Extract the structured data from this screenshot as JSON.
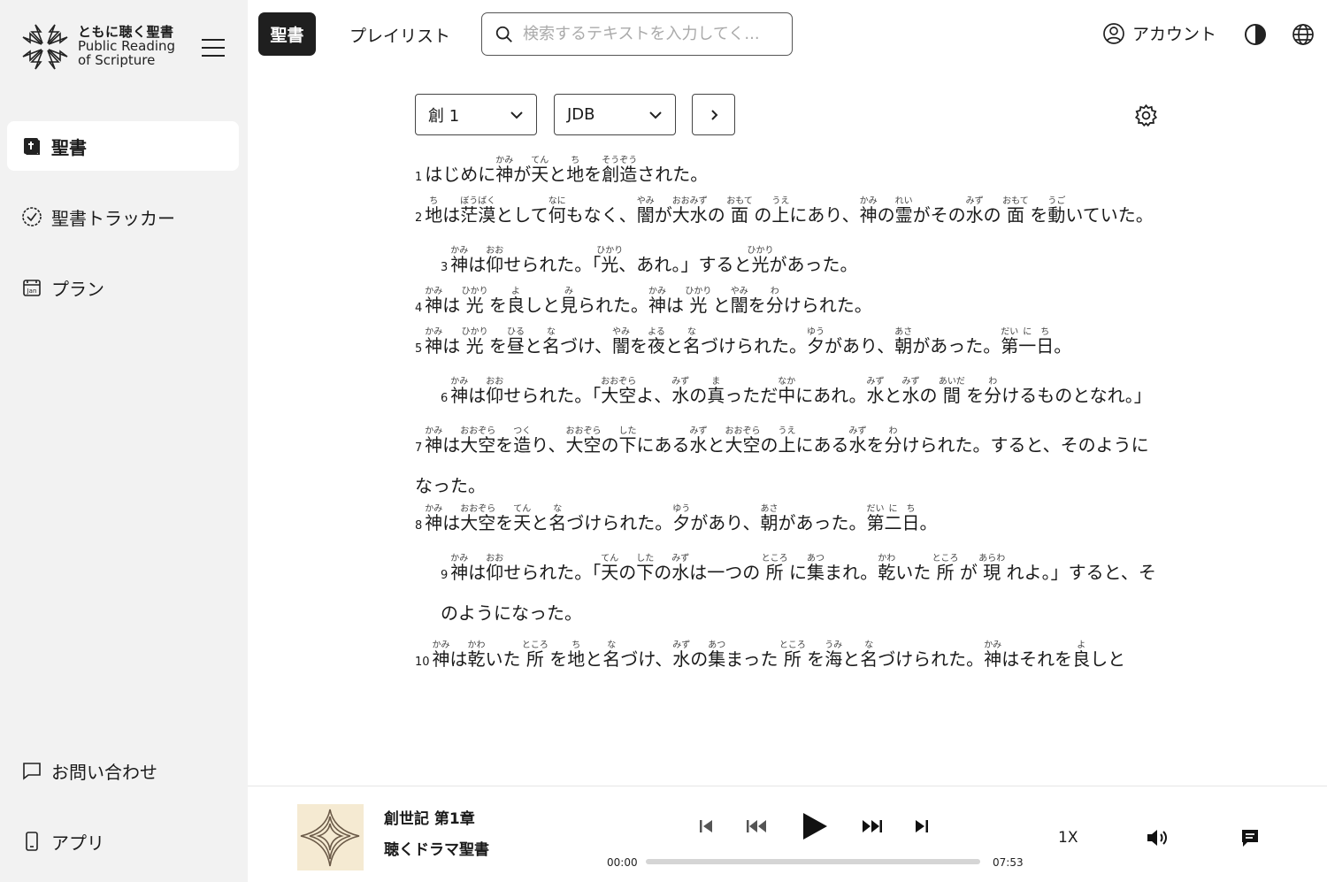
{
  "logo": {
    "title_jp": "ともに聴く聖書",
    "title_en_1": "Public Reading",
    "title_en_2": "of Scripture"
  },
  "sidebar": {
    "items": [
      {
        "label": "聖書",
        "icon": "bible-icon",
        "active": true
      },
      {
        "label": "聖書トラッカー",
        "icon": "check-circle-icon"
      },
      {
        "label": "プラン",
        "icon": "calendar-icon"
      }
    ],
    "bottom_items": [
      {
        "label": "お問い合わせ",
        "icon": "chat-icon"
      },
      {
        "label": "アプリ",
        "icon": "phone-icon"
      }
    ]
  },
  "topbar": {
    "tab_bible": "聖書",
    "tab_playlist": "プレイリスト",
    "search_placeholder": "検索するテキストを入力してく...",
    "account_label": "アカウント"
  },
  "controls": {
    "chapter": "創 1",
    "version": "JDB"
  },
  "reading": {
    "verses": [
      {
        "n": "1",
        "indent": false,
        "parts": [
          "はじめに",
          {
            "b": "神",
            "r": "かみ"
          },
          "が",
          {
            "b": "天",
            "r": "てん"
          },
          "と",
          {
            "b": "地",
            "r": "ち"
          },
          "を",
          {
            "b": "創造",
            "r": "そうぞう"
          },
          "された。"
        ]
      },
      {
        "n": "2",
        "indent": false,
        "parts": [
          {
            "b": "地",
            "r": "ち"
          },
          "は",
          {
            "b": "茫漠",
            "r": "ぼうばく"
          },
          "として",
          {
            "b": "何",
            "r": "なに"
          },
          "もなく、",
          {
            "b": "闇",
            "r": "やみ"
          },
          "が",
          {
            "b": "大水",
            "r": "おおみず"
          },
          "の ",
          {
            "b": "面",
            "r": "おもて"
          },
          " の",
          {
            "b": "上",
            "r": "うえ"
          },
          "にあり、",
          {
            "b": "神",
            "r": "かみ"
          },
          "の",
          {
            "b": "霊",
            "r": "れい"
          },
          "がその",
          {
            "b": "水",
            "r": "みず"
          },
          "の ",
          {
            "b": "面",
            "r": "おもて"
          },
          " を",
          {
            "b": "動",
            "r": "うご"
          },
          "いていた。"
        ]
      },
      {
        "n": "3",
        "indent": true,
        "parts": [
          {
            "b": "神",
            "r": "かみ"
          },
          "は",
          {
            "b": "仰",
            "r": "おお"
          },
          "せられた。「",
          {
            "b": "光",
            "r": "ひかり"
          },
          "、あれ。」すると",
          {
            "b": "光",
            "r": "ひかり"
          },
          "があった。"
        ]
      },
      {
        "n": "4",
        "indent": false,
        "parts": [
          {
            "b": "神",
            "r": "かみ"
          },
          "は ",
          {
            "b": "光",
            "r": "ひかり"
          },
          " を",
          {
            "b": "良",
            "r": "よ"
          },
          "しと",
          {
            "b": "見",
            "r": "み"
          },
          "られた。",
          {
            "b": "神",
            "r": "かみ"
          },
          "は ",
          {
            "b": "光",
            "r": "ひかり"
          },
          " と",
          {
            "b": "闇",
            "r": "やみ"
          },
          "を",
          {
            "b": "分",
            "r": "わ"
          },
          "けられた。"
        ]
      },
      {
        "n": "5",
        "indent": false,
        "parts": [
          {
            "b": "神",
            "r": "かみ"
          },
          "は ",
          {
            "b": "光",
            "r": "ひかり"
          },
          " を",
          {
            "b": "昼",
            "r": "ひる"
          },
          "と",
          {
            "b": "名",
            "r": "な"
          },
          "づけ、",
          {
            "b": "闇",
            "r": "やみ"
          },
          "を",
          {
            "b": "夜",
            "r": "よる"
          },
          "と",
          {
            "b": "名",
            "r": "な"
          },
          "づけられた。",
          {
            "b": "夕",
            "r": "ゆう"
          },
          "があり、",
          {
            "b": "朝",
            "r": "あさ"
          },
          "があった。",
          {
            "b": "第",
            "r": "だい"
          },
          {
            "b": "一日",
            "r": "にち"
          },
          "。"
        ]
      },
      {
        "n": "6",
        "indent": true,
        "parts": [
          {
            "b": "神",
            "r": "かみ"
          },
          "は",
          {
            "b": "仰",
            "r": "おお"
          },
          "せられた。「",
          {
            "b": "大空",
            "r": "おおぞら"
          },
          "よ、",
          {
            "b": "水",
            "r": "みず"
          },
          "の",
          {
            "b": "真",
            "r": "ま"
          },
          "っただ",
          {
            "b": "中",
            "r": "なか"
          },
          "にあれ。",
          {
            "b": "水",
            "r": "みず"
          },
          "と",
          {
            "b": "水",
            "r": "みず"
          },
          "の ",
          {
            "b": "間",
            "r": "あいだ"
          },
          " を",
          {
            "b": "分",
            "r": "わ"
          },
          "けるものとなれ。」"
        ]
      },
      {
        "n": "7",
        "indent": false,
        "parts": [
          {
            "b": "神",
            "r": "かみ"
          },
          "は",
          {
            "b": "大空",
            "r": "おおぞら"
          },
          "を",
          {
            "b": "造",
            "r": "つく"
          },
          "り、",
          {
            "b": "大空",
            "r": "おおぞら"
          },
          "の",
          {
            "b": "下",
            "r": "した"
          },
          "にある",
          {
            "b": "水",
            "r": "みず"
          },
          "と",
          {
            "b": "大空",
            "r": "おおぞら"
          },
          "の",
          {
            "b": "上",
            "r": "うえ"
          },
          "にある",
          {
            "b": "水",
            "r": "みず"
          },
          "を",
          {
            "b": "分",
            "r": "わ"
          },
          "けられた。すると、そのようになった。"
        ]
      },
      {
        "n": "8",
        "indent": false,
        "parts": [
          {
            "b": "神",
            "r": "かみ"
          },
          "は",
          {
            "b": "大空",
            "r": "おおぞら"
          },
          "を",
          {
            "b": "天",
            "r": "てん"
          },
          "と",
          {
            "b": "名",
            "r": "な"
          },
          "づけられた。",
          {
            "b": "夕",
            "r": "ゆう"
          },
          "があり、",
          {
            "b": "朝",
            "r": "あさ"
          },
          "があった。",
          {
            "b": "第",
            "r": "だい"
          },
          {
            "b": "二日",
            "r": "にち"
          },
          "。"
        ]
      },
      {
        "n": "9",
        "indent": true,
        "parts": [
          {
            "b": "神",
            "r": "かみ"
          },
          "は",
          {
            "b": "仰",
            "r": "おお"
          },
          "せられた。「",
          {
            "b": "天",
            "r": "てん"
          },
          "の",
          {
            "b": "下",
            "r": "した"
          },
          "の",
          {
            "b": "水",
            "r": "みず"
          },
          "は一つの ",
          {
            "b": "所",
            "r": "ところ"
          },
          " に",
          {
            "b": "集",
            "r": "あつ"
          },
          "まれ。",
          {
            "b": "乾",
            "r": "かわ"
          },
          "いた ",
          {
            "b": "所",
            "r": "ところ"
          },
          " が ",
          {
            "b": "現",
            "r": "あらわ"
          },
          " れよ。」すると、そのようになった。"
        ]
      },
      {
        "n": "10",
        "indent": false,
        "parts": [
          {
            "b": "神",
            "r": "かみ"
          },
          "は",
          {
            "b": "乾",
            "r": "かわ"
          },
          "いた ",
          {
            "b": "所",
            "r": "ところ"
          },
          " を",
          {
            "b": "地",
            "r": "ち"
          },
          "と",
          {
            "b": "名",
            "r": "な"
          },
          "づけ、",
          {
            "b": "水",
            "r": "みず"
          },
          "の",
          {
            "b": "集",
            "r": "あつ"
          },
          "まった ",
          {
            "b": "所",
            "r": "ところ"
          },
          " を",
          {
            "b": "海",
            "r": "うみ"
          },
          "と",
          {
            "b": "名",
            "r": "な"
          },
          "づけられた。",
          {
            "b": "神",
            "r": "かみ"
          },
          "はそれを",
          {
            "b": "良",
            "r": "よ"
          },
          "しと"
        ]
      }
    ]
  },
  "player": {
    "title": "創世記 第1章",
    "subtitle": "聴くドラマ聖書",
    "current_time": "00:00",
    "duration": "07:53",
    "progress": 0,
    "speed": "1X"
  }
}
